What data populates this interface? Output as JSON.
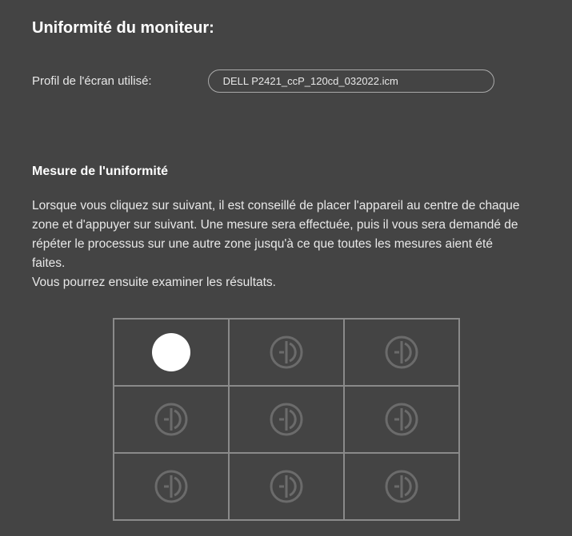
{
  "title": "Uniformité du moniteur:",
  "profile": {
    "label": "Profil de l'écran utilisé:",
    "value": "DELL P2421_ccP_120cd_032022.icm"
  },
  "section": {
    "heading": "Mesure de l'uniformité",
    "instructions": "Lorsque vous cliquez sur suivant, il est conseillé de placer l'appareil au centre de chaque zone et d'appuyer sur suivant. Une mesure sera effectuée, puis il vous sera demandé de répéter le processus sur une autre zone jusqu'à ce que toutes les mesures aient été faites.\nVous pourrez ensuite examiner les résultats."
  },
  "grid": {
    "rows": 3,
    "cols": 3,
    "active_index": 0,
    "zones": [
      {
        "id": "zone-1",
        "active": true,
        "measured": false
      },
      {
        "id": "zone-2",
        "active": false,
        "measured": false
      },
      {
        "id": "zone-3",
        "active": false,
        "measured": false
      },
      {
        "id": "zone-4",
        "active": false,
        "measured": false
      },
      {
        "id": "zone-5",
        "active": false,
        "measured": false
      },
      {
        "id": "zone-6",
        "active": false,
        "measured": false
      },
      {
        "id": "zone-7",
        "active": false,
        "measured": false
      },
      {
        "id": "zone-8",
        "active": false,
        "measured": false
      },
      {
        "id": "zone-9",
        "active": false,
        "measured": false
      }
    ]
  },
  "colors": {
    "background": "#444444",
    "border": "#8a8a8a",
    "icon": "#6b6b6b",
    "active_dot": "#ffffff"
  }
}
